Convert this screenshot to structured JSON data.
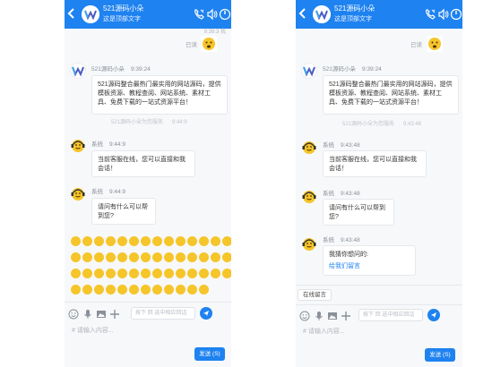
{
  "header": {
    "title": "521源码小朵",
    "subtitle": "这是顶部文字",
    "back_icon": "chevron-left-icon",
    "icons": [
      "phone-icon",
      "volume-icon",
      "power-icon"
    ],
    "bg_color": "#1e82f0"
  },
  "chat": {
    "top_timestamp": "9:39:3 我",
    "read_label": "已读",
    "welcome": {
      "sender": "521源码小朵",
      "time": "9:39:24",
      "text": "521源码整合最热门最实用的网站源码，提供模板资源、教程查阅、网站系统、素材工具、免费下载的一站式资源平台！"
    },
    "service_note": "521源码小朵为您服务",
    "service_note_time_left": "9:44:9",
    "service_note_time_right": "9:43:48",
    "system_name": "系统",
    "sys_msg1_time_left": "9:44:9",
    "sys_msg1_time_right": "9:43:48",
    "sys_msg1": "当前客服在线，您可以直接和我会话！",
    "sys_msg2_time_left": "9:44:9",
    "sys_msg2_time_right": "9:43:48",
    "sys_msg2": "请问有什么可以帮到您?",
    "sys_msg3_time_right": "9:43:48",
    "sys_msg3_text": "我猜你想问的:",
    "sys_msg3_link": "给我们留言"
  },
  "quick_reply": "在线留言",
  "input": {
    "quick_search_placeholder": "按下 回 选中相应回话",
    "placeholder": "# 请输入内容...",
    "send_label": "发送 (S)"
  },
  "colors": {
    "accent": "#1e82f0",
    "emoji": "#f5c52a"
  }
}
